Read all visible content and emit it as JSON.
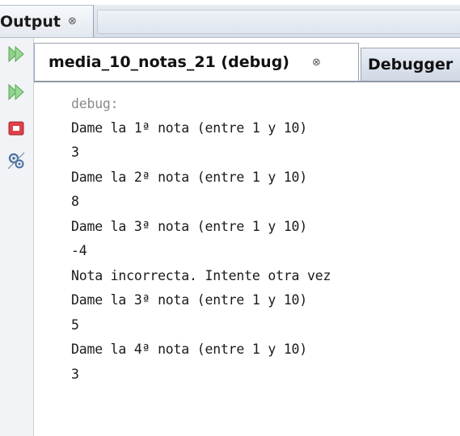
{
  "output_panel": {
    "title": "Output",
    "close_glyph": "⊗"
  },
  "tabs": [
    {
      "label": "media_10_notas_21 (debug)",
      "close_glyph": "⊗",
      "active": true
    },
    {
      "label": "Debugger",
      "active": false
    }
  ],
  "gutter_icons": [
    "rerun-icon",
    "rerun-with-options-icon",
    "stop-icon",
    "settings-icon"
  ],
  "console": {
    "lines": [
      "debug:",
      "Dame la 1ª nota (entre 1 y 10)",
      "3",
      "Dame la 2ª nota (entre 1 y 10)",
      "8",
      "Dame la 3ª nota (entre 1 y 10)",
      "-4",
      "Nota incorrecta. Intente otra vez",
      "Dame la 3ª nota (entre 1 y 10)",
      "5",
      "Dame la 4ª nota (entre 1 y 10)",
      "3"
    ]
  }
}
